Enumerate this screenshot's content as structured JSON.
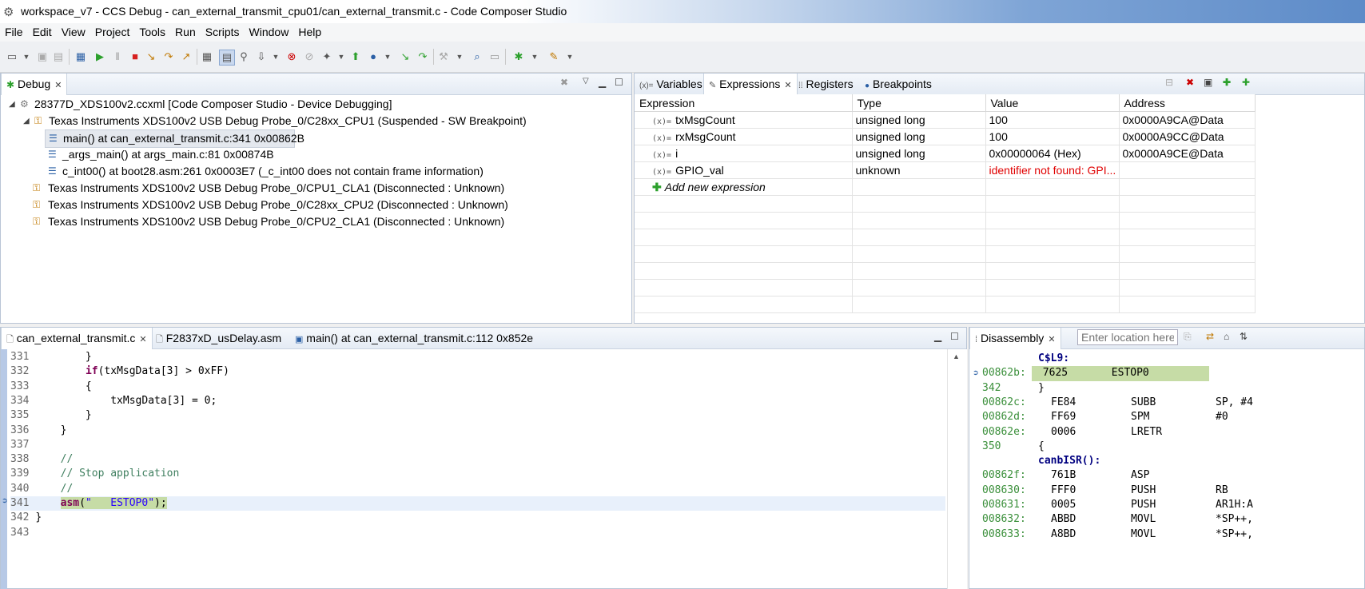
{
  "window": {
    "title": "workspace_v7 - CCS Debug - can_external_transmit_cpu01/can_external_transmit.c - Code Composer Studio"
  },
  "menu": [
    "File",
    "Edit",
    "View",
    "Project",
    "Tools",
    "Run",
    "Scripts",
    "Window",
    "Help"
  ],
  "debug_view": {
    "tab_label": "Debug",
    "tree": [
      {
        "label": "28377D_XDS100v2.ccxml [Code Composer Studio - Device Debugging]",
        "level": 0,
        "icon": "target-config-icon"
      },
      {
        "label": "Texas Instruments XDS100v2 USB Debug Probe_0/C28xx_CPU1 (Suspended - SW Breakpoint)",
        "level": 1,
        "icon": "suspended-core-icon"
      },
      {
        "label": "main() at can_external_transmit.c:341 0x00862B",
        "level": 2,
        "icon": "stack-frame-icon",
        "selected": true
      },
      {
        "label": "_args_main() at args_main.c:81 0x00874B",
        "level": 2,
        "icon": "stack-frame-icon"
      },
      {
        "label": "c_int00() at boot28.asm:261 0x0003E7  (_c_int00 does not contain frame information)",
        "level": 2,
        "icon": "stack-frame-icon"
      },
      {
        "label": "Texas Instruments XDS100v2 USB Debug Probe_0/CPU1_CLA1 (Disconnected : Unknown)",
        "level": 1,
        "icon": "disconnected-core-icon"
      },
      {
        "label": "Texas Instruments XDS100v2 USB Debug Probe_0/C28xx_CPU2 (Disconnected : Unknown)",
        "level": 1,
        "icon": "disconnected-core-icon"
      },
      {
        "label": "Texas Instruments XDS100v2 USB Debug Probe_0/CPU2_CLA1 (Disconnected : Unknown)",
        "level": 1,
        "icon": "disconnected-core-icon"
      }
    ]
  },
  "expressions_view": {
    "tabs": [
      "Variables",
      "Expressions",
      "Registers",
      "Breakpoints"
    ],
    "columns": [
      "Expression",
      "Type",
      "Value",
      "Address"
    ],
    "rows": [
      {
        "expression": "txMsgCount",
        "type": "unsigned long",
        "value": "100",
        "address": "0x0000A9CA@Data"
      },
      {
        "expression": "rxMsgCount",
        "type": "unsigned long",
        "value": "100",
        "address": "0x0000A9CC@Data"
      },
      {
        "expression": "i",
        "type": "unsigned long",
        "value": "0x00000064 (Hex)",
        "address": "0x0000A9CE@Data"
      },
      {
        "expression": "GPIO_val",
        "type": "unknown",
        "value": "identifier not found: GPI...",
        "address": "",
        "error": true
      }
    ],
    "add_new": "Add new expression",
    "error_color": "#e00000"
  },
  "editor": {
    "tabs": [
      "can_external_transmit.c",
      "F2837xD_usDelay.asm",
      "main() at can_external_transmit.c:112 0x852e"
    ],
    "lines": [
      {
        "n": "331",
        "text": "        }"
      },
      {
        "n": "332",
        "text": "        if(txMsgData[3] > 0xFF)"
      },
      {
        "n": "333",
        "text": "        {"
      },
      {
        "n": "334",
        "text": "            txMsgData[3] = 0;"
      },
      {
        "n": "335",
        "text": "        }"
      },
      {
        "n": "336",
        "text": "    }"
      },
      {
        "n": "337",
        "text": ""
      },
      {
        "n": "338",
        "text": "    //"
      },
      {
        "n": "339",
        "text": "    // Stop application"
      },
      {
        "n": "340",
        "text": "    //"
      },
      {
        "n": "341",
        "text": "    asm(\"   ESTOP0\");"
      },
      {
        "n": "342",
        "text": "}"
      },
      {
        "n": "343",
        "text": ""
      }
    ],
    "current_line": "341"
  },
  "disassembly": {
    "tab_label": "Disassembly",
    "location_placeholder": "Enter location here",
    "lines": [
      {
        "kind": "label",
        "text": "C$L9:"
      },
      {
        "kind": "instr",
        "addr": "00862b:",
        "op": "7625",
        "mnem": "ESTOP0",
        "args": "",
        "current": true
      },
      {
        "kind": "src",
        "addr": "342",
        "text": "}"
      },
      {
        "kind": "instr",
        "addr": "00862c:",
        "op": "FE84",
        "mnem": "SUBB",
        "args": "SP, #4"
      },
      {
        "kind": "instr",
        "addr": "00862d:",
        "op": "FF69",
        "mnem": "SPM",
        "args": "#0"
      },
      {
        "kind": "instr",
        "addr": "00862e:",
        "op": "0006",
        "mnem": "LRETR",
        "args": ""
      },
      {
        "kind": "src",
        "addr": "350",
        "text": "{"
      },
      {
        "kind": "label",
        "text": "canbISR():"
      },
      {
        "kind": "instr",
        "addr": "00862f:",
        "op": "761B",
        "mnem": "ASP",
        "args": ""
      },
      {
        "kind": "instr",
        "addr": "008630:",
        "op": "FFF0",
        "mnem": "PUSH",
        "args": "RB"
      },
      {
        "kind": "instr",
        "addr": "008631:",
        "op": "0005",
        "mnem": "PUSH",
        "args": "AR1H:A"
      },
      {
        "kind": "instr",
        "addr": "008632:",
        "op": "ABBD",
        "mnem": "MOVL",
        "args": "*SP++,"
      },
      {
        "kind": "instr",
        "addr": "008633:",
        "op": "A8BD",
        "mnem": "MOVL",
        "args": "*SP++,"
      }
    ]
  }
}
